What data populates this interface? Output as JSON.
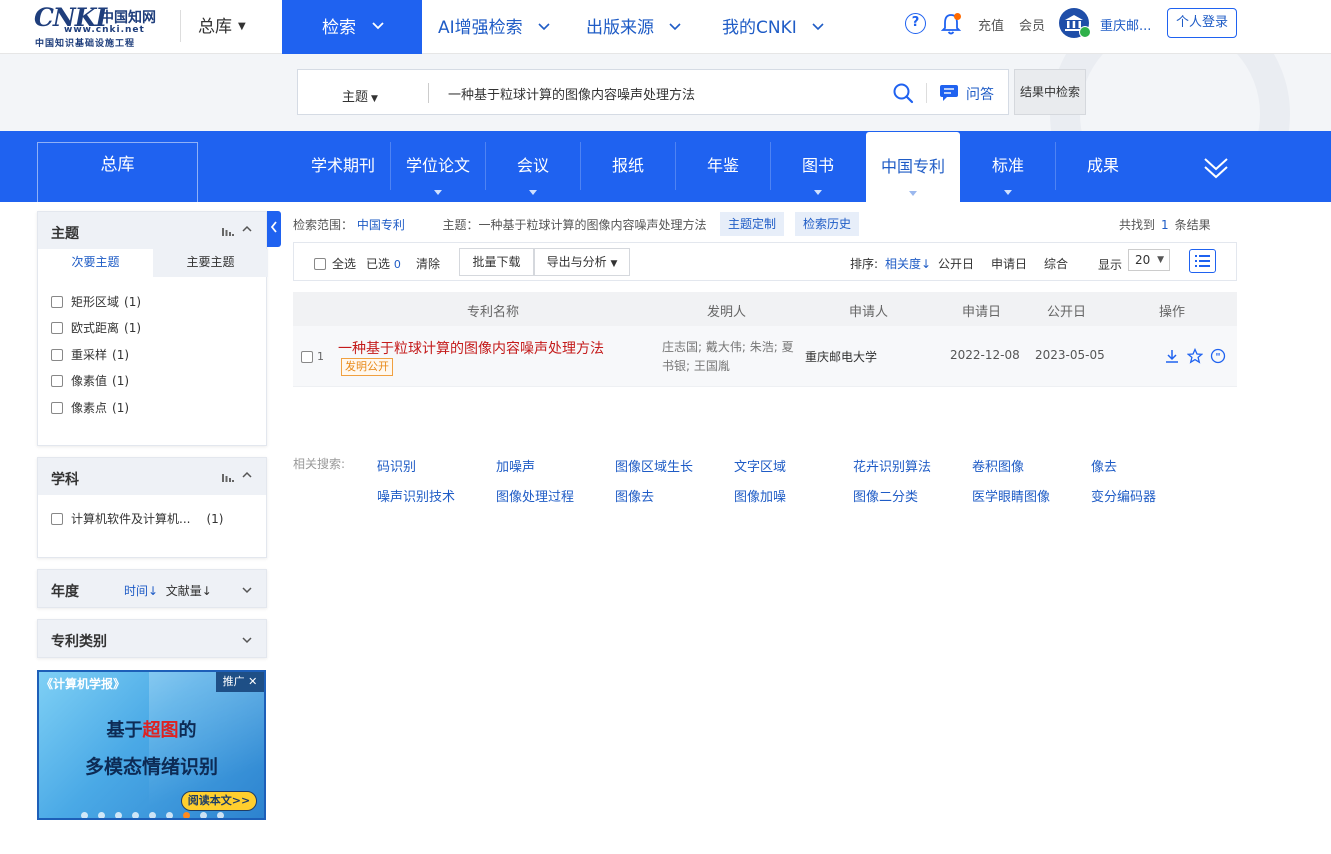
{
  "header": {
    "logo_text": "CNKI",
    "logo_cn": "中国知网",
    "logo_url": "www.cnki.net",
    "logo_sub": "中国知识基础设施工程",
    "library": "总库",
    "nav": [
      {
        "label": "检索"
      },
      {
        "label": "AI增强检索"
      },
      {
        "label": "出版来源"
      },
      {
        "label": "我的CNKI"
      }
    ],
    "help": "?",
    "recharge": "充值",
    "member": "会员",
    "institution": "重庆邮...",
    "login": "个人登录"
  },
  "search": {
    "field": "主题",
    "query": "一种基于粒球计算的图像内容噪声处理方法",
    "qa_label": "问答",
    "in_results": "结果中检索"
  },
  "databases": {
    "all": "总库",
    "tabs": [
      {
        "label": "学术期刊",
        "has_menu": false
      },
      {
        "label": "学位论文",
        "has_menu": true
      },
      {
        "label": "会议",
        "has_menu": true
      },
      {
        "label": "报纸",
        "has_menu": false
      },
      {
        "label": "年鉴",
        "has_menu": false
      },
      {
        "label": "图书",
        "has_menu": true
      },
      {
        "label": "中国专利",
        "has_menu": true,
        "active": true
      },
      {
        "label": "标准",
        "has_menu": true
      },
      {
        "label": "成果",
        "has_menu": false
      }
    ]
  },
  "sidebar": {
    "topic": {
      "title": "主题",
      "subtabs": [
        "次要主题",
        "主要主题"
      ],
      "items": [
        {
          "label": "矩形区域",
          "count": "(1)"
        },
        {
          "label": "欧式距离",
          "count": "(1)"
        },
        {
          "label": "重采样",
          "count": "(1)"
        },
        {
          "label": "像素值",
          "count": "(1)"
        },
        {
          "label": "像素点",
          "count": "(1)"
        }
      ]
    },
    "discipline": {
      "title": "学科",
      "items": [
        {
          "label": "计算机软件及计算机...",
          "count": "(1)"
        }
      ]
    },
    "year": {
      "title": "年度",
      "sort_time": "时间↓",
      "sort_count": "文献量↓"
    },
    "patent_type": {
      "title": "专利类别"
    },
    "ad": {
      "journal": "《计算机学报》",
      "promo": "推广",
      "line1_pre": "基于",
      "line1_hl": "超图",
      "line1_post": "的",
      "line2": "多模态情绪识别",
      "read": "阅读本文>>"
    }
  },
  "results": {
    "scope_label": "检索范围：",
    "scope_value": "中国专利",
    "topic_label": "主题：",
    "topic_value": "一种基于粒球计算的图像内容噪声处理方法",
    "customize": "主题定制",
    "history": "检索历史",
    "found_pre": "共找到",
    "found_count": "1",
    "found_post": "条结果",
    "toolbar": {
      "select_all": "全选",
      "selected_label": "已选",
      "selected_count": "0",
      "clear": "清除",
      "batch_download": "批量下载",
      "export": "导出与分析",
      "sort_label": "排序:",
      "sort_options": [
        "相关度",
        "公开日",
        "申请日",
        "综合"
      ],
      "display_label": "显示",
      "page_size": "20"
    },
    "columns": [
      "专利名称",
      "发明人",
      "申请人",
      "申请日",
      "公开日",
      "操作"
    ],
    "rows": [
      {
        "num": "1",
        "title": "一种基于粒球计算的图像内容噪声处理方法",
        "tag": "发明公开",
        "inventors_line1": "庄志国; 戴大伟; 朱浩; 夏",
        "inventors_line2": "书银; 王国胤",
        "applicant": "重庆邮电大学",
        "apply_date": "2022-12-08",
        "publish_date": "2023-05-05"
      }
    ],
    "related_label": "相关搜索:",
    "related": [
      "码识别",
      "加噪声",
      "图像区域生长",
      "文字区域",
      "花卉识别算法",
      "卷积图像",
      "像去",
      "噪声识别技术",
      "图像处理过程",
      "图像去",
      "图像加噪",
      "图像二分类",
      "医学眼睛图像",
      "变分编码器"
    ]
  }
}
